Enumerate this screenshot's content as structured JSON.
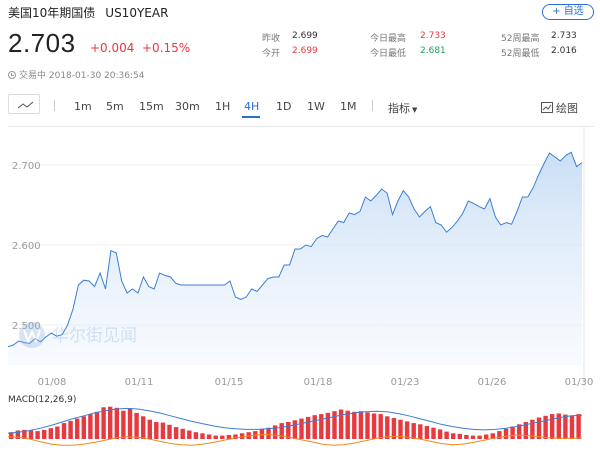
{
  "header": {
    "title": "美国10年期国债",
    "code": "US10YEAR",
    "add_button": "+ 自选"
  },
  "quote": {
    "price": "2.703",
    "change": "+0.004",
    "change_pct": "+0.15%",
    "status": "交易中 2018-01-30 20:36:54"
  },
  "stats": [
    {
      "label": "昨收",
      "value": "2.699",
      "color": "neutral"
    },
    {
      "label": "今开",
      "value": "2.699",
      "color": "red"
    },
    {
      "label": "今日最高",
      "value": "2.733",
      "color": "red"
    },
    {
      "label": "今日最低",
      "value": "2.681",
      "color": "green"
    },
    {
      "label": "52周最高",
      "value": "2.733",
      "color": "neutral"
    },
    {
      "label": "52周最低",
      "value": "2.016",
      "color": "neutral"
    }
  ],
  "toolbar": {
    "periods": [
      "1m",
      "5m",
      "15m",
      "30m",
      "1H",
      "4H",
      "1D",
      "1W",
      "1M"
    ],
    "active_period": "4H",
    "indicator_label": "指标",
    "draw_label": "绘图",
    "line_icon": "line-chart-icon",
    "draw_icon": "drawing-icon"
  },
  "watermark": "华尔街见闻",
  "colors": {
    "accent": "#2b6fd6",
    "up": "#e8393f",
    "down": "#1fa05a",
    "line": "#3b7fd4",
    "macd_line": "#f08a1c"
  },
  "chart_data": {
    "type": "area",
    "ylim": [
      2.45,
      2.74
    ],
    "y_ticks": [
      "2.700",
      "2.600",
      "2.500"
    ],
    "x_ticks": [
      "01/08",
      "01/11",
      "01/15",
      "01/18",
      "01/23",
      "01/26",
      "01/30"
    ],
    "series": [
      {
        "values": [
          2.473,
          2.475,
          2.48,
          2.478,
          2.477,
          2.483,
          2.479,
          2.485,
          2.49,
          2.486,
          2.488,
          2.5,
          2.52,
          2.55,
          2.556,
          2.555,
          2.548,
          2.565,
          2.545,
          2.593,
          2.59,
          2.555,
          2.54,
          2.545,
          2.54,
          2.56,
          2.548,
          2.545,
          2.565,
          2.562,
          2.56,
          2.552,
          2.55,
          2.55,
          2.55,
          2.55,
          2.55,
          2.55,
          2.55,
          2.55,
          2.55,
          2.555,
          2.535,
          2.532,
          2.535,
          2.545,
          2.542,
          2.55,
          2.558,
          2.56,
          2.56,
          2.575,
          2.575,
          2.595,
          2.595,
          2.6,
          2.598,
          2.608,
          2.612,
          2.61,
          2.62,
          2.63,
          2.628,
          2.64,
          2.638,
          2.642,
          2.66,
          2.655,
          2.662,
          2.67,
          2.665,
          2.638,
          2.655,
          2.668,
          2.66,
          2.645,
          2.635,
          2.642,
          2.648,
          2.628,
          2.625,
          2.616,
          2.622,
          2.63,
          2.64,
          2.655,
          2.652,
          2.648,
          2.645,
          2.658,
          2.635,
          2.625,
          2.628,
          2.626,
          2.642,
          2.66,
          2.66,
          2.672,
          2.688,
          2.702,
          2.715,
          2.71,
          2.705,
          2.712,
          2.716,
          2.698,
          2.703
        ]
      }
    ],
    "macd": {
      "label": "MACD(12,26,9)",
      "histogram": [
        1.2,
        1.5,
        1.6,
        1.5,
        1.4,
        1.6,
        1.9,
        2.2,
        2.8,
        3.2,
        3.6,
        4.0,
        4.4,
        4.8,
        5.6,
        5.7,
        5.5,
        5.0,
        5.4,
        4.6,
        4.0,
        3.4,
        3.0,
        2.9,
        2.5,
        2.1,
        1.8,
        1.5,
        1.2,
        1.0,
        0.8,
        0.6,
        0.6,
        0.7,
        0.8,
        1.0,
        1.2,
        1.4,
        1.7,
        2.0,
        2.4,
        2.8,
        3.0,
        3.3,
        3.6,
        3.9,
        4.2,
        4.4,
        4.6,
        4.9,
        5.2,
        5.0,
        4.8,
        4.9,
        4.7,
        4.5,
        4.4,
        4.0,
        3.7,
        3.4,
        3.1,
        2.8,
        2.6,
        2.3,
        2.0,
        1.7,
        1.3,
        1.0,
        0.9,
        0.7,
        0.6,
        0.6,
        0.8,
        1.0,
        1.4,
        1.8,
        2.2,
        2.6,
        3.0,
        3.4,
        3.8,
        4.1,
        4.4,
        4.5,
        4.3,
        4.1,
        4.4
      ],
      "dif": [
        1.0,
        1.2,
        1.5,
        1.9,
        2.4,
        3.0,
        3.6,
        4.1,
        4.6,
        5.0,
        5.3,
        5.4,
        5.3,
        5.0,
        4.6,
        4.1,
        3.6,
        3.1,
        2.7,
        2.3,
        2.0,
        1.8,
        1.7,
        1.7,
        1.8,
        2.0,
        2.3,
        2.7,
        3.1,
        3.5,
        3.9,
        4.3,
        4.6,
        4.8,
        4.9,
        4.8,
        4.5,
        4.1,
        3.6,
        3.1,
        2.6,
        2.2,
        1.9,
        1.7,
        1.6,
        1.7,
        1.9,
        2.2,
        2.6,
        3.0,
        3.4,
        3.8,
        4.1,
        4.2
      ],
      "dea": [
        0.4,
        0.3,
        0.0,
        -0.5,
        -0.9,
        -1.1,
        -1.1,
        -0.9,
        -0.6,
        -0.2,
        0.2,
        0.4,
        0.3,
        0.0,
        -0.4,
        -0.8,
        -1.0,
        -1.1,
        -0.9,
        -0.6,
        -0.2,
        0.2,
        0.5,
        0.7,
        0.8,
        0.6,
        0.3,
        -0.1,
        -0.5,
        -0.9,
        -1.1,
        -1.0,
        -0.7,
        -0.3,
        0.1,
        0.4,
        0.5,
        0.3,
        0.0,
        -0.4,
        -0.8,
        -1.0,
        -0.9,
        -0.6,
        -0.2,
        0.2,
        0.5,
        0.7,
        0.6,
        0.4,
        0.2,
        0.1,
        0.1,
        0.2
      ]
    }
  }
}
